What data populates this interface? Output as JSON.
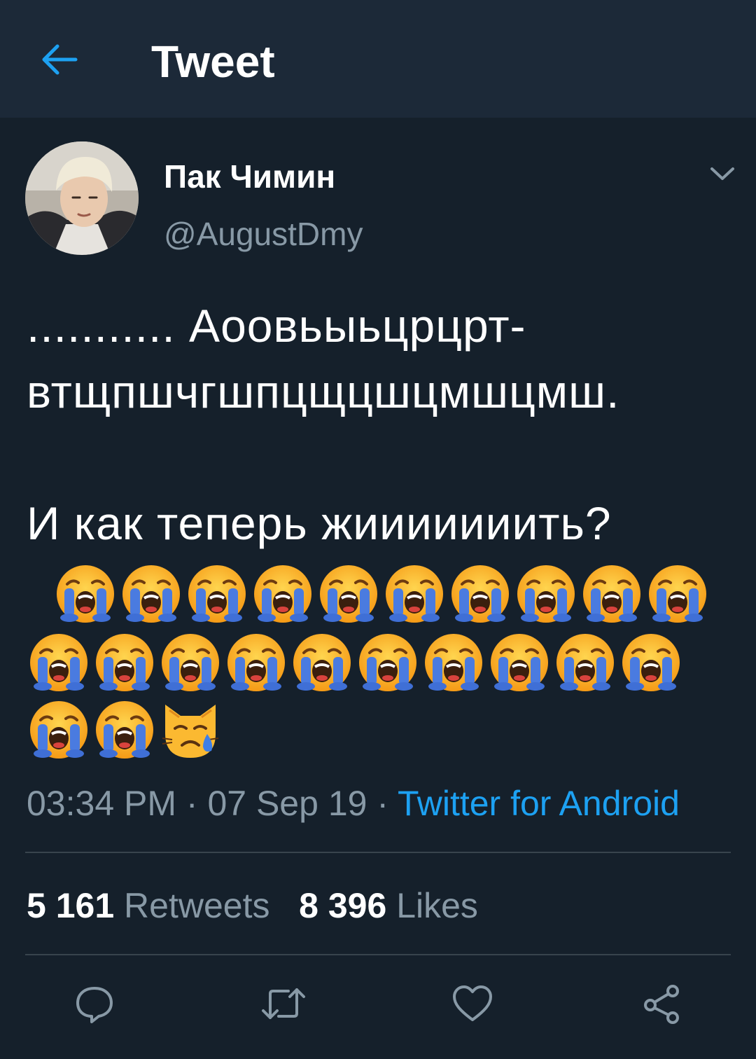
{
  "header": {
    "title": "Tweet",
    "back_icon": "arrow-left-icon"
  },
  "tweet": {
    "author": {
      "display_name": "Пак Чимин",
      "handle": "@AugustDmy"
    },
    "text_lines": [
      "........... Аоовьыьцрцрт-",
      "втщпшчгшпцщцшцмшцмш.",
      "",
      "И как теперь жииииииить?"
    ],
    "emoji": {
      "crying_face_count": 22,
      "crying_cat_count": 1,
      "row_counts": [
        10,
        10,
        3
      ]
    },
    "time": "03:34 PM",
    "separator": " · ",
    "date": "07 Sep 19",
    "source": "Twitter for Android",
    "retweets_count": "5 161",
    "retweets_label": "Retweets",
    "likes_count": "8 396",
    "likes_label": "Likes"
  },
  "actions": [
    "reply-icon",
    "retweet-icon",
    "like-icon",
    "share-icon"
  ],
  "colors": {
    "background": "#15202b",
    "topbar": "#1c2938",
    "accent": "#1da1f2",
    "secondary_text": "#8899a6",
    "divider": "#38444d"
  }
}
